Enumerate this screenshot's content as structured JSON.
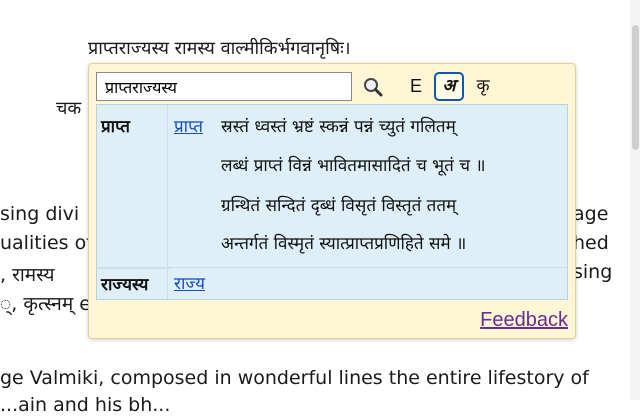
{
  "background": {
    "sanskrit_line": "प्राप्तराज्यस्य रामस्य वाल्मीकिर्भगवानृषिः।",
    "partial_chak": "चक",
    "line3_left": "sing divi",
    "line3_right": "age",
    "line4_left": "ualities of",
    "line4_right": "hed",
    "line5_left": ", रामस्य ",
    "line5_right": "sing",
    "line6_left": "्, कृत्स्नम् e",
    "bottom_line": "ge Valmiki, composed in wonderful lines the entire lifestory of",
    "bottom_line2": "...ain and his bh..."
  },
  "popup": {
    "search_value": "प्राप्तराज्यस्य",
    "buttons": {
      "search_icon": "magnifier-icon",
      "english": "E",
      "devanagari": "अ",
      "kr": "कृ"
    },
    "results": [
      {
        "word": "प्राप्त",
        "root": "प्राप्त",
        "verse": [
          "स्रस्तं ध्वस्तं भ्रष्टं स्कन्नं पन्नं च्युतं गलितम्",
          "लब्धं प्राप्तं विन्नं भावितमासादितं च भूतं च ॥",
          "ग्रन्थितं सन्दितं दृब्धं विसृतं विस्तृतं ततम्",
          "अन्तर्गतं विस्मृतं स्यात्प्राप्तप्रणिहिते समे ॥"
        ]
      },
      {
        "word": "राज्यस्य",
        "root": "राज्य"
      }
    ],
    "feedback_label": "Feedback"
  }
}
